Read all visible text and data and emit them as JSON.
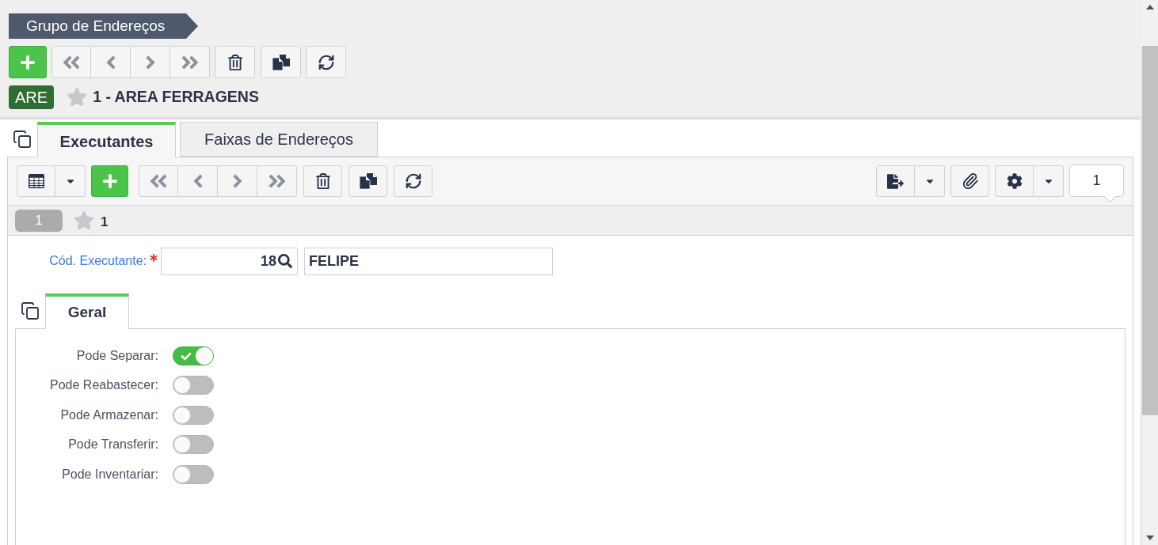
{
  "page_title": "Grupo de Endereços",
  "record": {
    "badge": "ARE",
    "starred": false,
    "title": "1 - AREA FERRAGENS"
  },
  "tabs": [
    {
      "label": "Executantes",
      "selected": true
    },
    {
      "label": "Faixas de Endereços",
      "selected": false
    }
  ],
  "detail": {
    "record_counter": "1",
    "record_row": {
      "index": "1",
      "starred": false,
      "title": "1"
    },
    "field": {
      "label": "Cód. Executante:",
      "required": true,
      "code": "18",
      "name": "FELIPE"
    },
    "sub_tabs": [
      {
        "label": "Geral",
        "selected": true
      }
    ],
    "switches": [
      {
        "label": "Pode Separar:",
        "on": true
      },
      {
        "label": "Pode Reabastecer:",
        "on": false
      },
      {
        "label": "Pode Armazenar:",
        "on": false
      },
      {
        "label": "Pode Transferir:",
        "on": false
      },
      {
        "label": "Pode Inventariar:",
        "on": false
      }
    ]
  }
}
